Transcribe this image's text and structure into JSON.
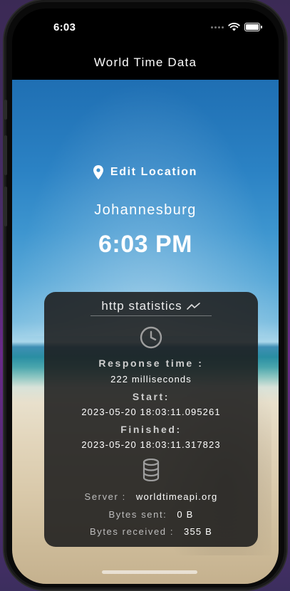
{
  "status_bar": {
    "time": "6:03"
  },
  "nav": {
    "title": "World Time Data"
  },
  "location": {
    "edit_label": "Edit Location",
    "city": "Johannesburg",
    "time": "6:03 PM"
  },
  "stats": {
    "header": "http statistics",
    "response_time_label": "Response time :",
    "response_time_value": "222 milliseconds",
    "start_label": "Start:",
    "start_value": "2023-05-20 18:03:11.095261",
    "finished_label": "Finished:",
    "finished_value": "2023-05-20 18:03:11.317823",
    "server_label": "Server :",
    "server_value": "worldtimeapi.org",
    "bytes_sent_label": "Bytes sent:",
    "bytes_sent_value": "0 B",
    "bytes_received_label": "Bytes received :",
    "bytes_received_value": "355 B"
  },
  "icons": {
    "location": "location-pin-icon",
    "trend": "trending-line-icon",
    "clock": "clock-icon",
    "database": "database-icon",
    "wifi": "wifi-icon",
    "battery": "battery-icon"
  },
  "colors": {
    "card_bg": "#1c1c1c",
    "text": "#ffffff",
    "sky": "#2b82c4",
    "sand": "#e2d5bb"
  }
}
